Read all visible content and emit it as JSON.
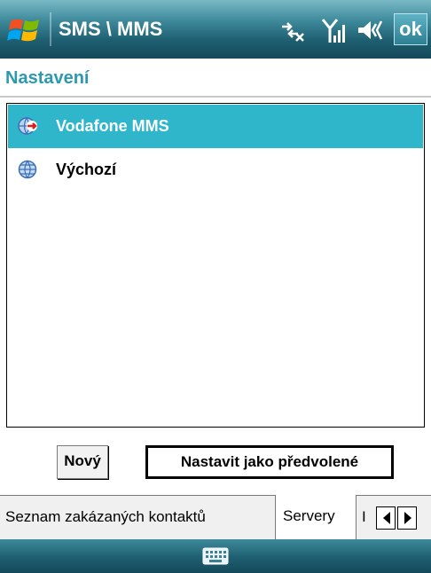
{
  "titlebar": {
    "app_title": "SMS \\ MMS",
    "ok_label": "ok",
    "icons": [
      "windows-start-icon",
      "connectivity-icon",
      "signal-strength-icon",
      "volume-icon"
    ]
  },
  "heading": "Nastavení",
  "accounts": [
    {
      "label": "Vodafone MMS",
      "selected": true,
      "icon": "globe-active-icon"
    },
    {
      "label": "Výchozí",
      "selected": false,
      "icon": "globe-icon"
    }
  ],
  "buttons": {
    "new_label": "Nový",
    "set_default_label": "Nastavit jako předvolené"
  },
  "tabs": [
    {
      "label": "Seznam zakázaných kontaktů",
      "active": false
    },
    {
      "label": "Servery",
      "active": true
    },
    {
      "label": "I",
      "active": false
    }
  ],
  "softbar": {
    "icon": "keyboard-icon"
  },
  "colors": {
    "accent": "#2c99b0",
    "selection": "#2fb6cb",
    "titlebar": "#1d5e70"
  }
}
